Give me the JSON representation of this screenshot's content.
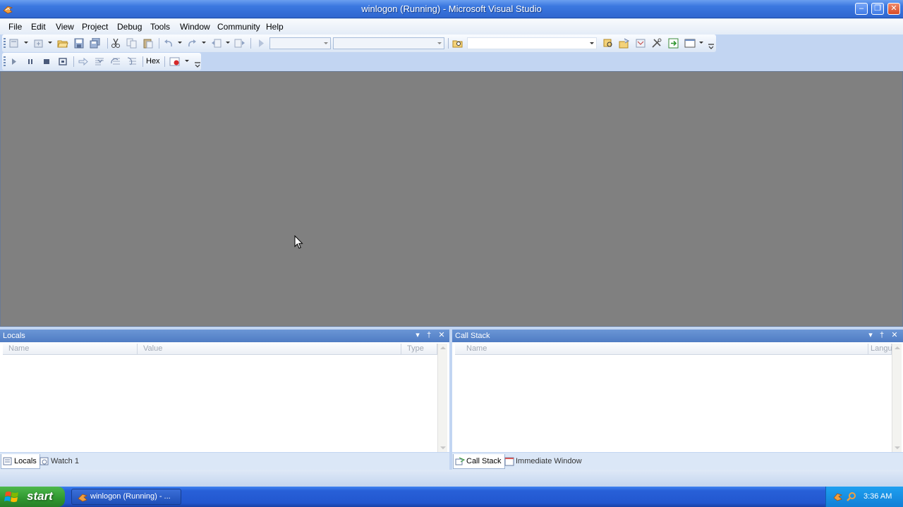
{
  "window": {
    "title": "winlogon (Running) - Microsoft Visual Studio",
    "minimize_glyph": "–",
    "restore_glyph": "❐",
    "close_glyph": "✕"
  },
  "menu": {
    "items": [
      "File",
      "Edit",
      "View",
      "Project",
      "Debug",
      "Tools",
      "Window",
      "Community",
      "Help"
    ]
  },
  "debug_toolbar": {
    "hex_label": "Hex"
  },
  "locals_pane": {
    "title": "Locals",
    "columns": [
      "Name",
      "Value",
      "Type"
    ],
    "rows": []
  },
  "callstack_pane": {
    "title": "Call Stack",
    "columns": [
      "Name",
      "Langu"
    ],
    "rows": []
  },
  "left_tabs": [
    "Locals",
    "Watch 1"
  ],
  "right_tabs": [
    "Call Stack",
    "Immediate Window"
  ],
  "pane_buttons": {
    "dropdown_glyph": "▾",
    "pin_glyph": "†",
    "close_glyph": "✕"
  },
  "taskbar": {
    "start_label": "start",
    "task_label": "winlogon (Running) - ...",
    "clock": "3:36 AM"
  },
  "colors": {
    "titlebar": "#2f66d0",
    "editor_bg": "#808080",
    "pane_header": "#4f7cc4",
    "taskbar": "#2257cf",
    "start_button": "#2f962f",
    "tray": "#127fd6"
  }
}
